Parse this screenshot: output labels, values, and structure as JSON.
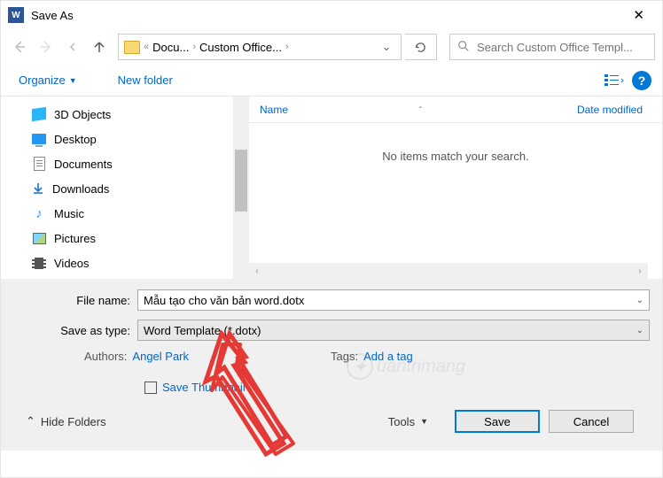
{
  "dialog": {
    "title": "Save As"
  },
  "breadcrumb": {
    "part1": "Docu...",
    "part2": "Custom Office..."
  },
  "search": {
    "placeholder": "Search Custom Office Templ..."
  },
  "toolbar": {
    "organize": "Organize",
    "newfolder": "New folder"
  },
  "sidebar": {
    "items": [
      {
        "label": "3D Objects"
      },
      {
        "label": "Desktop"
      },
      {
        "label": "Documents"
      },
      {
        "label": "Downloads"
      },
      {
        "label": "Music"
      },
      {
        "label": "Pictures"
      },
      {
        "label": "Videos"
      }
    ]
  },
  "filelist": {
    "col_name": "Name",
    "col_date": "Date modified",
    "empty": "No items match your search."
  },
  "form": {
    "name_label": "File name:",
    "name_value": "Mẫu tạo cho văn bản word.dotx",
    "type_label": "Save as type:",
    "type_value": "Word Template (*.dotx)",
    "authors_label": "Authors:",
    "authors_value": "Angel Park",
    "tags_label": "Tags:",
    "tags_value": "Add a tag",
    "thumb": "Save Thumbnail"
  },
  "footer": {
    "hide": "Hide Folders",
    "tools": "Tools",
    "save": "Save",
    "cancel": "Cancel"
  },
  "watermark": "uantrimang"
}
